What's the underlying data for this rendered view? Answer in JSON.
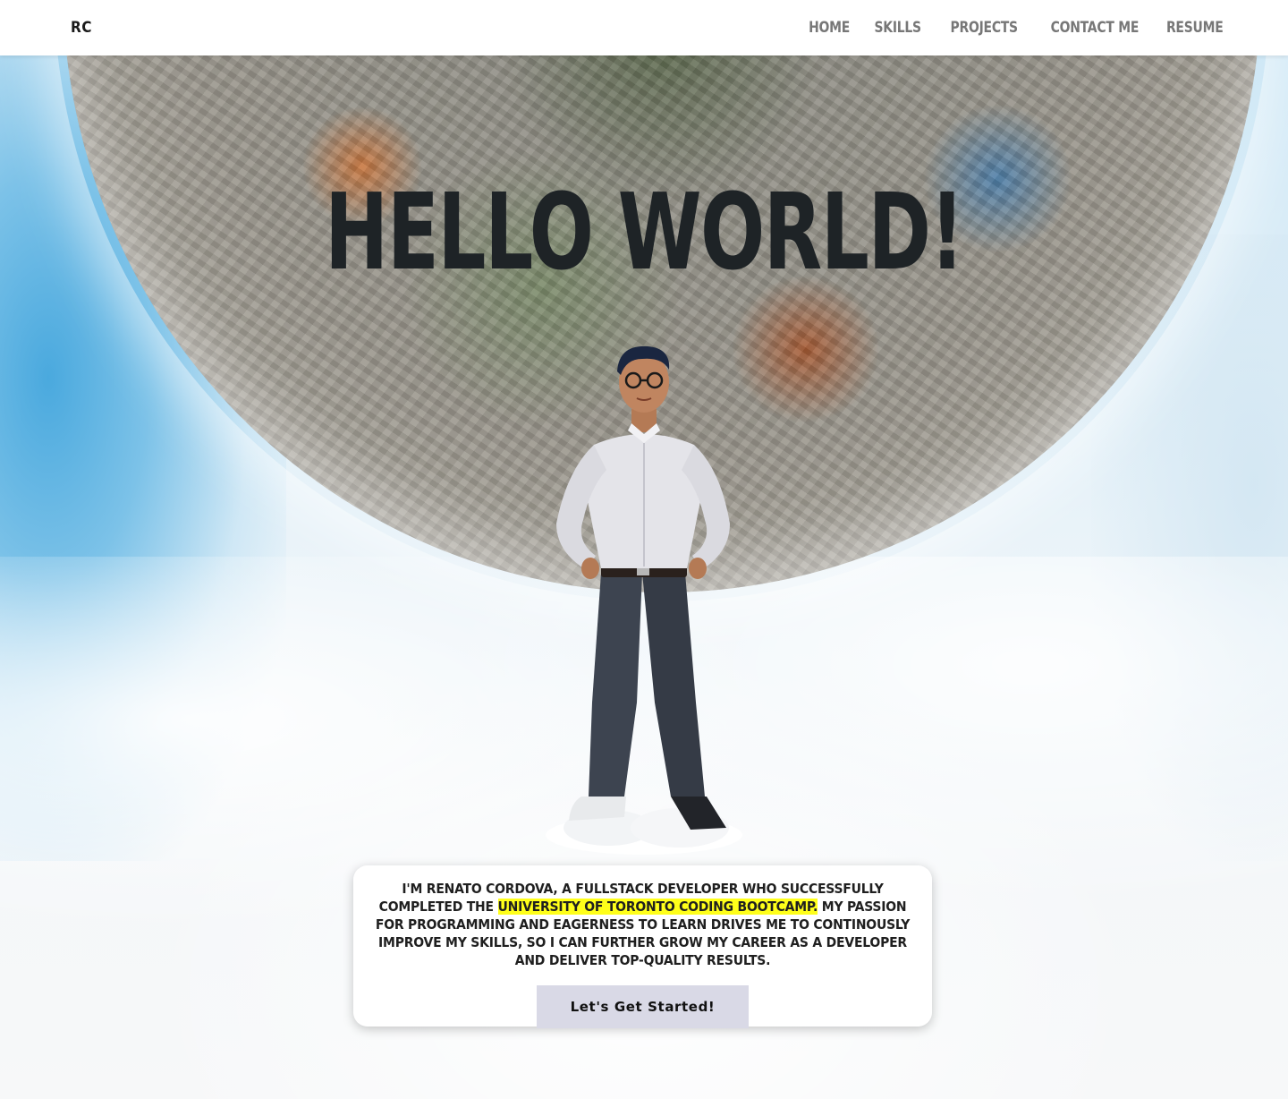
{
  "navbar": {
    "brand": "RC",
    "links": [
      {
        "label": "HOME"
      },
      {
        "label": "SKILLS"
      },
      {
        "label": "PROJECTS"
      },
      {
        "label": "CONTACT ME"
      },
      {
        "label": "RESUME"
      }
    ]
  },
  "hero": {
    "headline": "HELLO WORLD!",
    "intro": {
      "before": "I'M RENATO CORDOVA, A FULLSTACK DEVELOPER WHO SUCCESSFULLY COMPLETED THE ",
      "highlight": "UNIVERSITY OF TORONTO CODING BOOTCAMP.",
      "after": " MY PASSION FOR PROGRAMMING AND EAGERNESS TO LEARN DRIVES ME TO CONTINOUSLY IMPROVE MY SKILLS, SO I CAN FURTHER GROW MY CAREER AS A DEVELOPER AND DELIVER TOP-QUALITY RESULTS."
    },
    "cta_label": "Let's Get Started!"
  },
  "colors": {
    "highlight": "#ffff1a",
    "cta_background": "#d9d9e6",
    "nav_link": "#777777",
    "headline": "#1e2326"
  }
}
